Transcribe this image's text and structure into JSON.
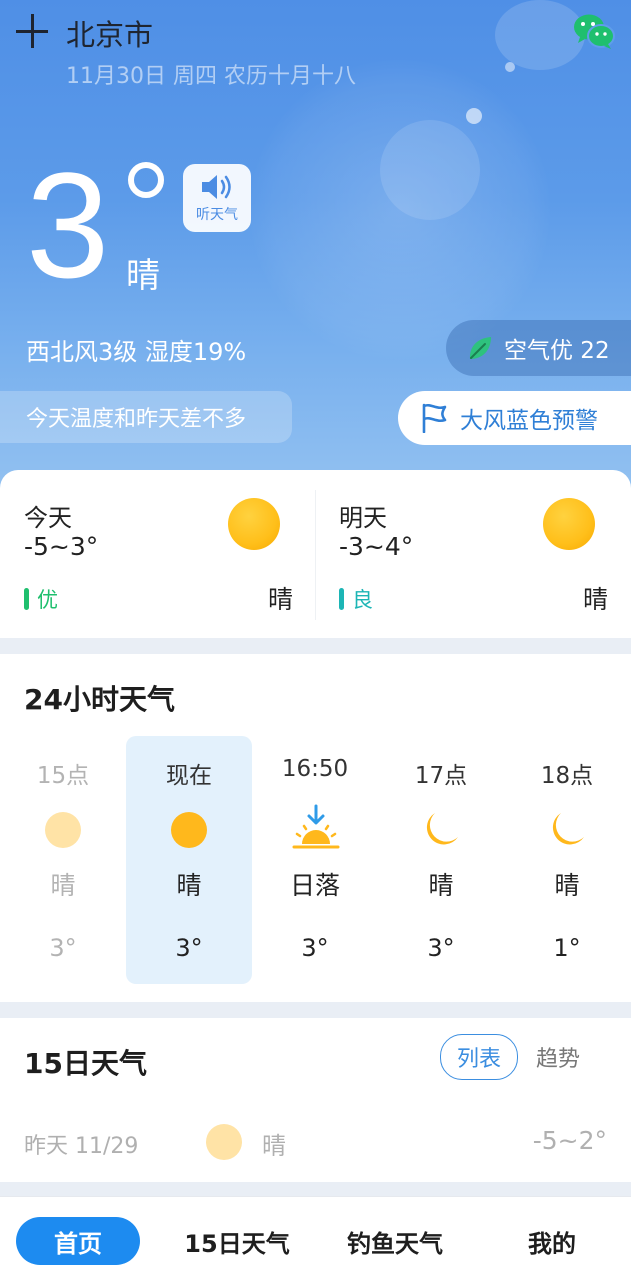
{
  "header": {
    "city": "北京市",
    "date_line": "11月30日 周四 农历十月十八"
  },
  "current": {
    "temperature": "3",
    "condition": "晴",
    "listen_label": "听天气",
    "wind_humidity": "西北风3级 湿度19%",
    "air_quality": "空气优 22",
    "comparison": "今天温度和昨天差不多",
    "warning": "大风蓝色预警"
  },
  "days": [
    {
      "name": "今天",
      "range": "-5~3°",
      "aq": "优",
      "aq_color": "#1fbf6e",
      "condition": "晴"
    },
    {
      "name": "明天",
      "range": "-3~4°",
      "aq": "良",
      "aq_color": "#1cb5b5",
      "condition": "晴"
    }
  ],
  "hourly": {
    "title": "24小时天气",
    "items": [
      {
        "time": "15点",
        "icon": "sun-icon",
        "condition": "晴",
        "temp": "3°"
      },
      {
        "time": "现在",
        "icon": "sun-icon",
        "condition": "晴",
        "temp": "3°"
      },
      {
        "time": "16:50",
        "icon": "sunset-icon",
        "condition": "日落",
        "temp": "3°"
      },
      {
        "time": "17点",
        "icon": "moon-icon",
        "condition": "晴",
        "temp": "3°"
      },
      {
        "time": "18点",
        "icon": "moon-icon",
        "condition": "晴",
        "temp": "1°"
      }
    ]
  },
  "daily": {
    "title": "15日天气",
    "list_label": "列表",
    "trend_label": "趋势",
    "yesterday": {
      "label": "昨天 11/29",
      "condition": "晴",
      "range": "-5~2°"
    }
  },
  "nav": {
    "home": "首页",
    "fifteen_day": "15日天气",
    "fishing": "钓鱼天气",
    "mine": "我的"
  },
  "colors": {
    "accent": "#1d8bf0",
    "sun": "#ffbf1a",
    "wechat": "#1fbf6e"
  }
}
